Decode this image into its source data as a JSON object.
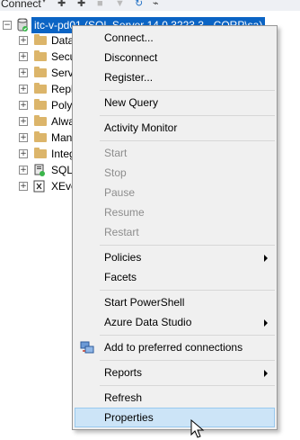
{
  "toolbar": {
    "connect_label": "Connect",
    "connect_caret": "▾",
    "icons": [
      "connect-icon",
      "disconnect-icon",
      "stop-icon",
      "filter-icon",
      "refresh-icon",
      "activity-icon"
    ]
  },
  "tree": {
    "server": {
      "expander": "−",
      "label": "itc-v-pd01 (SQL Server 14.0.3223.3 - CORP\\sa)"
    },
    "items": [
      {
        "label": "Data",
        "icon": "folder"
      },
      {
        "label": "Secu",
        "icon": "folder"
      },
      {
        "label": "Serv",
        "icon": "folder"
      },
      {
        "label": "Repl",
        "icon": "folder"
      },
      {
        "label": "Poly",
        "icon": "folder"
      },
      {
        "label": "Alwa",
        "icon": "folder"
      },
      {
        "label": "Man",
        "icon": "folder"
      },
      {
        "label": "Integ",
        "icon": "folder"
      },
      {
        "label": "SQL",
        "icon": "sql-agent"
      },
      {
        "label": "XEve",
        "icon": "xevent"
      }
    ],
    "expander_glyph": "+"
  },
  "menu": {
    "connect": "Connect...",
    "disconnect": "Disconnect",
    "register": "Register...",
    "new_query": "New Query",
    "activity_monitor": "Activity Monitor",
    "start": "Start",
    "stop": "Stop",
    "pause": "Pause",
    "resume": "Resume",
    "restart": "Restart",
    "policies": "Policies",
    "facets": "Facets",
    "start_powershell": "Start PowerShell",
    "azure_data_studio": "Azure Data Studio",
    "add_preferred": "Add to preferred connections",
    "reports": "Reports",
    "refresh": "Refresh",
    "properties": "Properties"
  },
  "colors": {
    "selection": "#0b64c4",
    "menu_bg": "#f0f0f0",
    "highlight": "#cce4f7",
    "disabled_text": "#8d8d8d"
  }
}
